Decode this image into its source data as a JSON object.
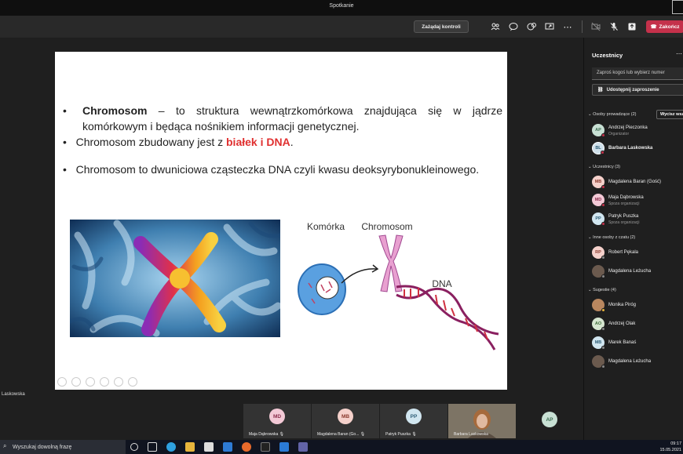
{
  "window": {
    "title": "Spotkanie"
  },
  "toolbar": {
    "request_control": "Zażądaj kontroli",
    "end_call": "Zakończ"
  },
  "slide": {
    "bullet1_bold": "Chromosom",
    "bullet1_rest": " – to struktura wewnątrzkomórkowa znajdująca się w jądrze komórkowym i będąca nośnikiem informacji genetycznej.",
    "bullet2_pre": "Chromosom zbudowany jest z ",
    "bullet2_red": "białek i DNA",
    "bullet2_post": ".",
    "bullet3": "Chromosom to dwuniciowa cząsteczka DNA czyli kwasu deoksyrybonukleinowego.",
    "diagram_labels": {
      "cell": "Komórka",
      "chromosome": "Chromosom",
      "dna": "DNA"
    }
  },
  "presenter_name": "Laskowska",
  "panel": {
    "title": "Uczestnicy",
    "invite_placeholder": "Zaproś kogoś lub wybierz numer",
    "share_invite": "Udostępnij zaproszenie",
    "mute_all": "Wycisz wszystkich",
    "sections": [
      {
        "label": "Osoby prowadzące (2)"
      },
      {
        "label": "Uczestnicy (3)"
      },
      {
        "label": "Inne osoby z czatu (2)"
      },
      {
        "label": "Sugestie (4)"
      }
    ],
    "presenters": [
      {
        "initials": "AP",
        "name": "Andrzej Pieczonka",
        "sub": "Organizator",
        "color": "#c8e0d4",
        "fg": "#3c6b50",
        "status": "#c4314b"
      },
      {
        "initials": "BL",
        "name": "Barbara Laskowska",
        "sub": "",
        "color": "#cfe0ea",
        "fg": "#2b5b74",
        "status": "#c4314b"
      }
    ],
    "attendees": [
      {
        "initials": "MB",
        "name": "Magdalena Baran (Gość)",
        "sub": "",
        "color": "#f5d1cb",
        "fg": "#8a3a2e",
        "status": "#c4314b"
      },
      {
        "initials": "MD",
        "name": "Maja Dąbrowska",
        "sub": "Spoza organizacji",
        "color": "#f3c9d6",
        "fg": "#8a2d4c",
        "status": "#c4314b"
      },
      {
        "initials": "PP",
        "name": "Patryk Puszka",
        "sub": "Spoza organizacji",
        "color": "#d1e6f0",
        "fg": "#2f5f78",
        "status": "#c4314b"
      }
    ],
    "chat_people": [
      {
        "initials": "RP",
        "name": "Robert Pękala",
        "sub": "",
        "color": "#f5d1cb",
        "fg": "#8a3a2e",
        "status": "#888"
      },
      {
        "initials": "ML",
        "name": "Magdalena Leżucha",
        "sub": "",
        "color": "#6b5a4e",
        "fg": "#fff",
        "status": "#888"
      }
    ],
    "suggestions": [
      {
        "initials": "MP",
        "name": "Monika Piróg",
        "sub": "",
        "color": "#b9875f",
        "fg": "#fff",
        "status": "#e8b53c"
      },
      {
        "initials": "AO",
        "name": "Andrzej Olak",
        "sub": "",
        "color": "#d6e6d0",
        "fg": "#3e6b38",
        "status": "#888"
      },
      {
        "initials": "MB",
        "name": "Marek Banaś",
        "sub": "",
        "color": "#d1e6f0",
        "fg": "#2f5f78",
        "status": "#888"
      },
      {
        "initials": "ML",
        "name": "Magdalena Leżucha",
        "sub": "",
        "color": "#6b5a4e",
        "fg": "#fff",
        "status": "#888"
      }
    ]
  },
  "thumbnails": [
    {
      "initials": "MD",
      "name": "Maja Dąbrowska",
      "color": "#f3c9d6",
      "fg": "#8a2d4c"
    },
    {
      "initials": "MB",
      "name": "Magdalena Baran (Go...",
      "color": "#f5d1cb",
      "fg": "#8a3a2e"
    },
    {
      "initials": "PP",
      "name": "Patryk Puszka",
      "color": "#d1e6f0",
      "fg": "#2f5f78"
    },
    {
      "initials": "",
      "name": "Barbara Laskowska",
      "color": "#8a8070",
      "fg": "#fff"
    }
  ],
  "thumb_extra": {
    "initials": "AP"
  },
  "taskbar": {
    "search_placeholder": "Wyszukaj dowolną frazę",
    "time": "09:17",
    "date": "15.05.2021"
  }
}
